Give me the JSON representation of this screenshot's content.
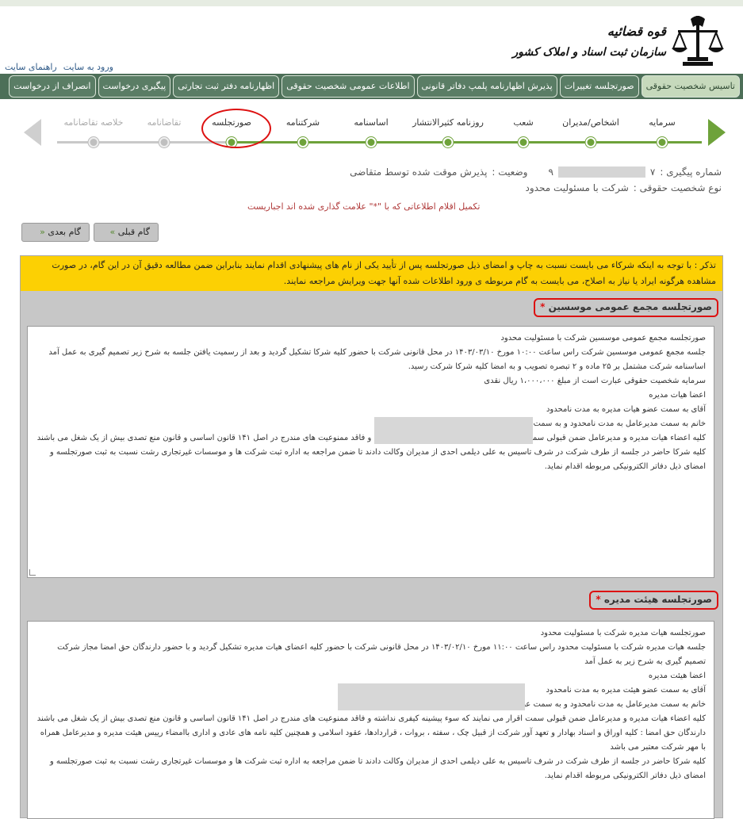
{
  "header": {
    "logo_title": "قوه قضائیه",
    "logo_subtitle": "سازمان ثبت اسناد و املاک کشور",
    "links": [
      "ورود به سایت",
      "راهنمای سایت"
    ]
  },
  "nav": {
    "tabs": [
      {
        "label": "تاسیس شخصیت حقوقی",
        "active": true
      },
      {
        "label": "صورتجلسه تغییرات",
        "active": false
      },
      {
        "label": "پذیرش اظهارنامه پلمپ دفاتر قانونی",
        "active": false
      },
      {
        "label": "اطلاعات عمومی شخصیت حقوقی",
        "active": false
      },
      {
        "label": "اظهارنامه دفتر ثبت تجارتی",
        "active": false
      },
      {
        "label": "پیگیری درخواست",
        "active": false
      },
      {
        "label": "انصراف از درخواست",
        "active": false
      }
    ]
  },
  "steps": [
    {
      "label": "سرمایه",
      "state": "done"
    },
    {
      "label": "اشخاص/مدیران",
      "state": "done"
    },
    {
      "label": "شعب",
      "state": "done"
    },
    {
      "label": "روزنامه کثیرالانتشار",
      "state": "done"
    },
    {
      "label": "اساسنامه",
      "state": "done"
    },
    {
      "label": "شرکتنامه",
      "state": "done"
    },
    {
      "label": "صورتجلسه",
      "state": "current"
    },
    {
      "label": "تقاضانامه",
      "state": "future"
    },
    {
      "label": "خلاصه تقاضانامه",
      "state": "future"
    }
  ],
  "info": {
    "tracking_label": "شماره پیگیری :",
    "tracking_prefix": "۷",
    "tracking_suffix": "۹",
    "status_label": "وضعیت :",
    "status_value": "پذیرش موقت شده توسط متقاضی",
    "entity_type_label": "نوع شخصیت حقوقی :",
    "entity_type_value": "شرکت با مسئولیت محدود"
  },
  "hint": "تکمیل اقلام اطلاعاتی که با \"*\" علامت گذاری شده اند اجباریست",
  "buttons": {
    "prev": "گام قبلی",
    "next": "گام بعدی"
  },
  "notice": "تذکر : با توجه به اینکه شرکاء می بایست نسبت به چاپ و امضای ذیل صورتجلسه پس از تأیید یکی از نام های پیشنهادی اقدام نمایند بنابراین ضمن مطالعه دقیق آن در این گام، در صورت مشاهده هرگونه ایراد یا نیاز به اصلاح، می بایست به گام مربوطه ی ورود اطلاعات شده آنها جهت ویرایش مراجعه نمایند.",
  "sections": [
    {
      "title": "صورتجلسه مجمع عمومی موسسین",
      "lines": [
        "صورتجلسه مجمع عمومی موسسین شرکت با مسئولیت محدود",
        "جلسه مجمع عمومی موسسین شرکت راس ساعت ۱۰:۰۰ مورخ ۱۴۰۳/۰۳/۱۰ در محل قانونی شرکت با حضور کلیه شرکا تشکیل گردید و بعد از رسمیت یافتن جلسه به شرح زیر تصمیم گیری به عمل آمد",
        "اساسنامه شرکت مشتمل بر ۲۵ ماده و ۲ تبصره تصویب و به امضا کلیه شرکا شرکت رسید.",
        "سرمایه شخصیت حقوقی عبارت است از مبلغ ۱،۰۰۰،۰۰۰ ریال نقدی",
        "اعضا هیات مدیره",
        "آقای                                    به سمت عضو هیات مدیره به مدت نامحدود",
        "خانم                                    به سمت مدیرعامل به مدت نامحدود و به سمت عضو اصلی هیئت مدیره به مدت نامحدود",
        "کلیه اعضاء هیات مدیره و مدیرعامل ضمن قبولی سمت اقرار می نمایند که سوء پیشینه کیفری نداشته و فاقد ممنوعیت های مندرج در اصل ۱۴۱ قانون اساسی و قانون منع تصدی بیش از یک شغل می باشند",
        "کلیه شرکا حاضر در جلسه از طرف شرکت در شرف تاسیس به علی دیلمی احدی از مدیران وکالت دادند تا ضمن مراجعه به اداره ثبت شرکت ها و موسسات غیرتجاری رشت نسبت به ثبت صورتجلسه و امضای ذیل دفاتر الکترونیکی مربوطه اقدام نماید."
      ]
    },
    {
      "title": "صورتجلسه هیئت مدیره",
      "lines": [
        "صورتجلسه هیات مدیره شرکت با مسئولیت محدود",
        "جلسه هیات مدیره شرکت با مسئولیت محدود راس ساعت ۱۱:۰۰ مورخ ۱۴۰۳/۰۲/۱۰ در محل قانونی شرکت با حضور کلیه اعضای هیات مدیره تشکیل گردید و با حضور دارندگان حق امضا مجاز شرکت تصمیم گیری به شرح زیر به عمل آمد",
        "اعضا هیئت مدیره",
        "آقای                                    به سمت عضو هیئت مدیره به مدت نامحدود",
        "خانم                                    به سمت مدیرعامل به مدت نامحدود و به سمت عضو اصلی هیئت مدیره به مدت نامحدود",
        "کلیه اعضاء هیات مدیره و مدیرعامل ضمن قبولی سمت اقرار می نمایند که سوء پیشینه کیفری نداشته و فاقد ممنوعیت های مندرج در اصل ۱۴۱ قانون اساسی و قانون منع تصدی بیش از یک شغل می باشند",
        "دارندگان حق امضا : کلیه اوراق و اسناد بهادار و تعهد آور شرکت از قبیل چک ، سفته ، بروات ، قراردادها، عقود اسلامی و همچنین کلیه نامه های عادی و اداری باامضاء رییس هیئت مدیره و مدیرعامل همراه با مهر شرکت معتبر می باشد",
        "کلیه شرکا حاضر در جلسه از طرف شرکت در شرف تاسیس به علی دیلمی احدی از مدیران وکالت دادند تا ضمن مراجعه به اداره ثبت شرکت ها و موسسات غیرتجاری رشت نسبت به ثبت صورتجلسه و امضای ذیل دفاتر الکترونیکی مربوطه اقدام نماید."
      ]
    }
  ],
  "colors": {
    "nav_bg": "#4d6f58",
    "step_done": "#6ea23a",
    "notice_bg": "#fcd003",
    "highlight": "#dd1111"
  }
}
